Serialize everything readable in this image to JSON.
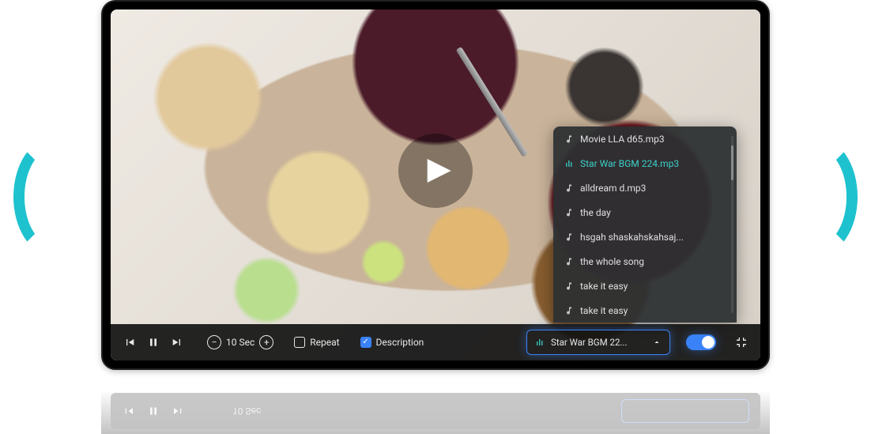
{
  "colors": {
    "accent": "#3a82f7",
    "teal": "#1ec2cf",
    "active_track": "#3bd1c9"
  },
  "player": {
    "seconds_step_label": "10 Sec",
    "repeat_label": "Repeat",
    "repeat_checked": false,
    "description_label": "Description",
    "description_checked": true,
    "bgm_toggle_on": true,
    "selected_bgm_label": "Star War BGM 22..."
  },
  "playlist": {
    "active_index": 1,
    "items": [
      {
        "label": "Movie LLA d65.mp3"
      },
      {
        "label": "Star War BGM 224.mp3"
      },
      {
        "label": "alldream d.mp3"
      },
      {
        "label": "the day"
      },
      {
        "label": "hsgah shaskahskahsaj..."
      },
      {
        "label": "the whole song"
      },
      {
        "label": "take it easy"
      },
      {
        "label": "take it easy"
      }
    ]
  }
}
